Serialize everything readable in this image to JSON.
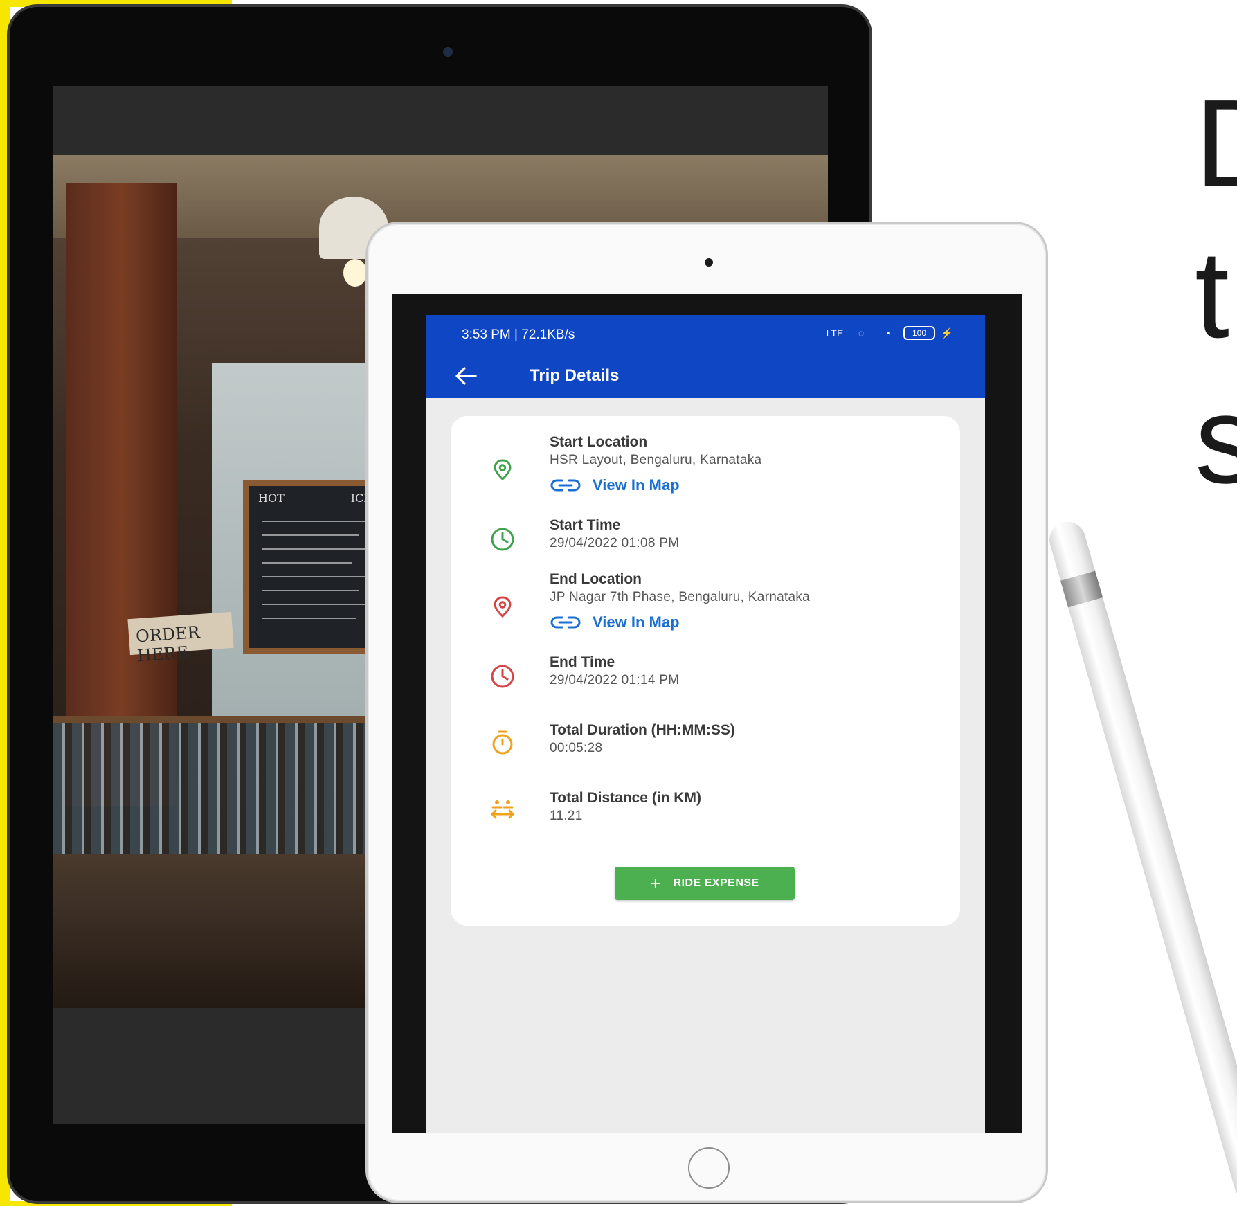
{
  "status_bar": {
    "time_speed": "3:53 PM | 72.1KB/s",
    "battery": "100",
    "network": "LTE"
  },
  "app_bar": {
    "title": "Trip Details"
  },
  "trip": {
    "start_location": {
      "label": "Start Location",
      "value": "HSR Layout, Bengaluru, Karnataka",
      "link": "View In Map"
    },
    "start_time": {
      "label": "Start Time",
      "value": "29/04/2022 01:08 PM"
    },
    "end_location": {
      "label": "End Location",
      "value": "JP Nagar 7th Phase, Bengaluru, Karnataka",
      "link": "View In Map"
    },
    "end_time": {
      "label": "End Time",
      "value": "29/04/2022 01:14 PM"
    },
    "duration": {
      "label": "Total Duration (HH:MM:SS)",
      "value": "00:05:28"
    },
    "distance": {
      "label": "Total Distance (in KM)",
      "value": "11.21"
    }
  },
  "buttons": {
    "ride_expense": "RIDE EXPENSE"
  },
  "background": {
    "order_sign": "ORDER HERE",
    "menu_board": {
      "left_header": "HOT",
      "right_header": "ICE"
    }
  },
  "headline_fragments": [
    "D",
    "t",
    "s"
  ],
  "colors": {
    "app_bar": "#0f46c4",
    "accent_green": "#4caf50",
    "icon_green": "#3fa34d",
    "icon_red": "#d64545",
    "icon_orange": "#f0a21a",
    "link_blue": "#1a6fd1",
    "yellow_accent": "#f7e600"
  },
  "icons": {
    "back": "arrow-left-icon",
    "start_location": "map-pin-icon",
    "start_time": "clock-icon",
    "end_location": "map-pin-icon",
    "end_time": "clock-icon",
    "duration": "stopwatch-icon",
    "distance": "distance-icon",
    "link": "link-icon",
    "add": "plus-icon"
  }
}
